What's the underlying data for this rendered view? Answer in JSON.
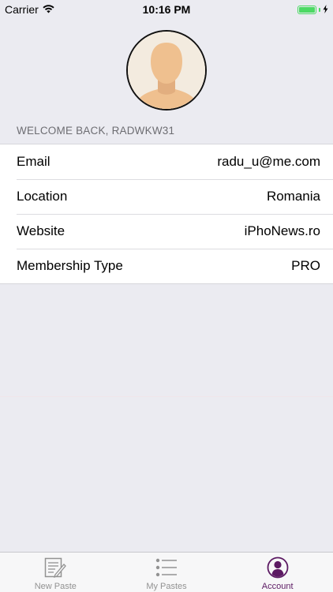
{
  "status_bar": {
    "carrier": "Carrier",
    "time": "10:16 PM",
    "battery_level": 1.0
  },
  "profile": {
    "section_header": "WELCOME BACK, RADWKW31"
  },
  "details": [
    {
      "label": "Email",
      "value": "radu_u@me.com"
    },
    {
      "label": "Location",
      "value": "Romania"
    },
    {
      "label": "Website",
      "value": "iPhoNews.ro"
    },
    {
      "label": "Membership Type",
      "value": "PRO"
    }
  ],
  "tab_bar": {
    "tabs": [
      {
        "label": "New Paste",
        "icon": "edit-document-icon",
        "active": false
      },
      {
        "label": "My Pastes",
        "icon": "list-icon",
        "active": false
      },
      {
        "label": "Account",
        "icon": "account-icon",
        "active": true
      }
    ]
  },
  "colors": {
    "accent": "#5c1a63",
    "battery": "#4cd964",
    "background": "#ebebf1"
  }
}
